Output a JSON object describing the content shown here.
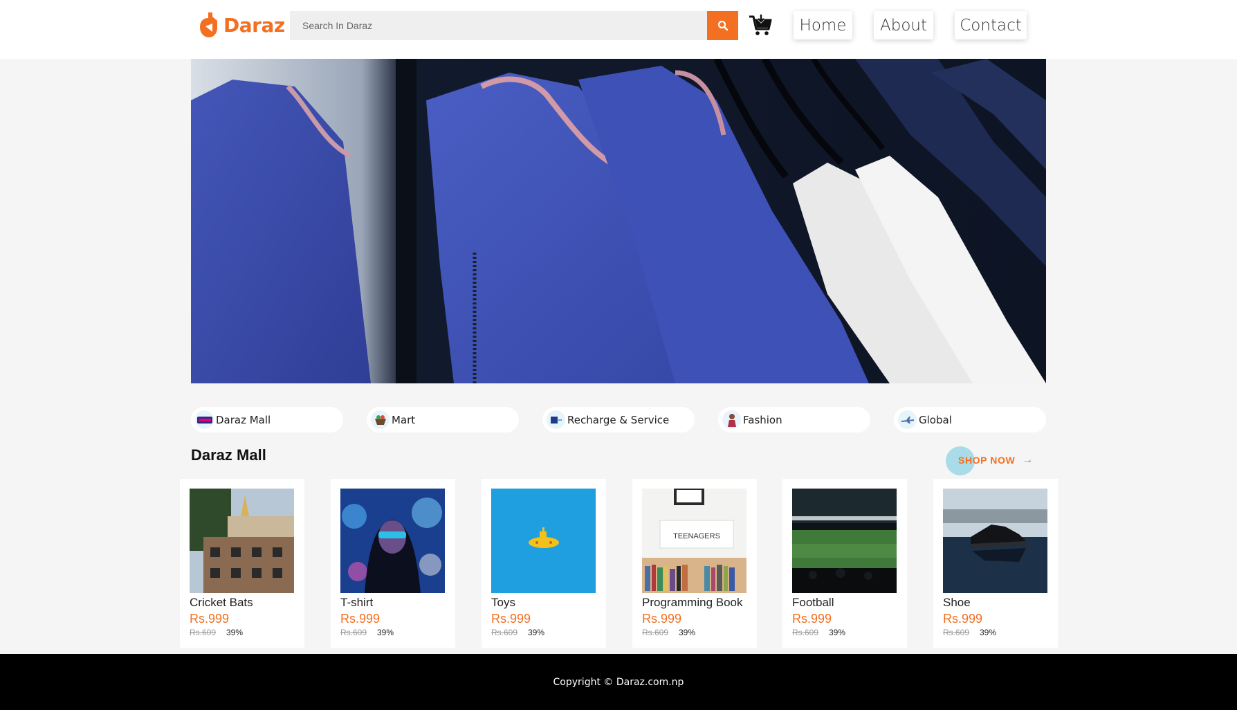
{
  "header": {
    "brand": "Daraz",
    "search_placeholder": "Search In Daraz",
    "nav": [
      {
        "label": "Home"
      },
      {
        "label": "About"
      },
      {
        "label": "Contact"
      }
    ]
  },
  "categories": [
    {
      "label": "Daraz Mall",
      "icon": "daraz-mall-icon"
    },
    {
      "label": "Mart",
      "icon": "basket-icon"
    },
    {
      "label": "Recharge & Service",
      "icon": "recharge-icon"
    },
    {
      "label": "Fashion",
      "icon": "fashion-icon"
    },
    {
      "label": "Global",
      "icon": "airplane-icon"
    }
  ],
  "section": {
    "title": "Daraz Mall",
    "shop_now": "SHOP NOW"
  },
  "products": [
    {
      "name": "Cricket Bats",
      "price": "Rs.999",
      "old_price": "Rs.609",
      "discount": "39%"
    },
    {
      "name": "T-shirt",
      "price": "Rs.999",
      "old_price": "Rs.609",
      "discount": "39%"
    },
    {
      "name": "Toys",
      "price": "Rs.999",
      "old_price": "Rs.609",
      "discount": "39%"
    },
    {
      "name": "Programming Book",
      "price": "Rs.999",
      "old_price": "Rs.609",
      "discount": "39%",
      "image_text": "TEENAGERS"
    },
    {
      "name": "Football",
      "price": "Rs.999",
      "old_price": "Rs.609",
      "discount": "39%"
    },
    {
      "name": "Shoe",
      "price": "Rs.999",
      "old_price": "Rs.609",
      "discount": "39%"
    }
  ],
  "footer": {
    "copyright": "Copyright © Daraz.com.np"
  },
  "colors": {
    "accent": "#f36f21",
    "footer_bg": "#000000",
    "page_bg": "#f5f5f5"
  }
}
